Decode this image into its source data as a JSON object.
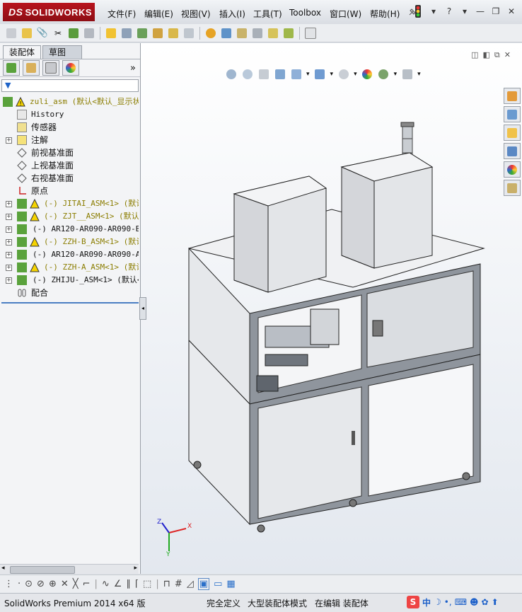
{
  "app": {
    "brand": "SOLIDWORKS",
    "brand_prefix": "DS"
  },
  "menu": [
    {
      "label": "文件(F)"
    },
    {
      "label": "编辑(E)"
    },
    {
      "label": "视图(V)"
    },
    {
      "label": "插入(I)"
    },
    {
      "label": "工具(T)"
    },
    {
      "label": "Toolbox"
    },
    {
      "label": "窗口(W)"
    },
    {
      "label": "帮助(H)"
    }
  ],
  "panel": {
    "tabs": [
      {
        "label": "装配体"
      },
      {
        "label": "草图"
      }
    ]
  },
  "tree": {
    "root": "zuli_asm  (默认<默认_显示状",
    "items": [
      {
        "label": "History"
      },
      {
        "label": "传感器"
      },
      {
        "label": "注解"
      },
      {
        "label": "前视基准面"
      },
      {
        "label": "上视基准面"
      },
      {
        "label": "右视基准面"
      },
      {
        "label": "原点"
      },
      {
        "label": "(-) JITAI_ASM<1> (默认<"
      },
      {
        "label": "(-) ZJT__ASM<1> (默认<显"
      },
      {
        "label": "(-) AR120-AR090-AR090-B_AS"
      },
      {
        "label": "(-) ZZH-B_ASM<1> (默认<"
      },
      {
        "label": "(-) AR120-AR090-AR090-A_AS"
      },
      {
        "label": "(-) ZZH-A_ASM<1> (默认<"
      },
      {
        "label": "(-) ZHIJU-_ASM<1> (默认<显"
      },
      {
        "label": "配合"
      }
    ]
  },
  "triad": {
    "x": "X",
    "y": "Y",
    "z": "Z"
  },
  "status": {
    "product": "SolidWorks Premium 2014 x64 版",
    "definition": "完全定义",
    "mode": "大型装配体模式",
    "editing": "在编辑 装配体"
  },
  "ime": {
    "lang": "中"
  },
  "colors": {
    "brand_red": "#a8101a",
    "warning": "#e8c400",
    "component": "#3a8a2a"
  }
}
